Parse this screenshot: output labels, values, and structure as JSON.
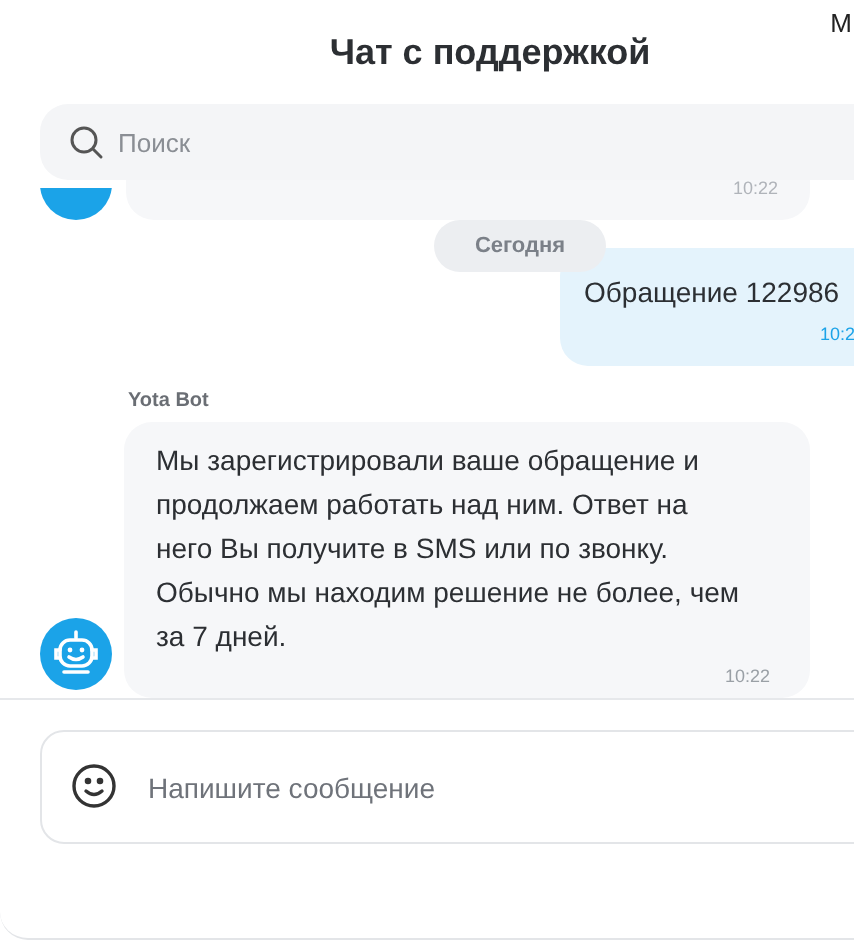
{
  "header": {
    "title": "Чат с поддержкой",
    "corner_text": "М"
  },
  "search": {
    "placeholder": "Поиск"
  },
  "messages": [
    {
      "kind": "bot_tail",
      "time": "10:22"
    },
    {
      "kind": "date",
      "text": "Сегодня"
    },
    {
      "kind": "user",
      "text": "Обращение 122986",
      "time": "10:2"
    },
    {
      "kind": "bot",
      "sender": "Yota Bot",
      "text": "Мы зарегистрировали ваше обращение и продолжаем работать над ним. Ответ на него Вы получите в SMS или по звонку. Обычно мы находим решение не более, чем за 7 дней.",
      "time": "10:22"
    }
  ],
  "composer": {
    "placeholder": "Напишите сообщение"
  }
}
